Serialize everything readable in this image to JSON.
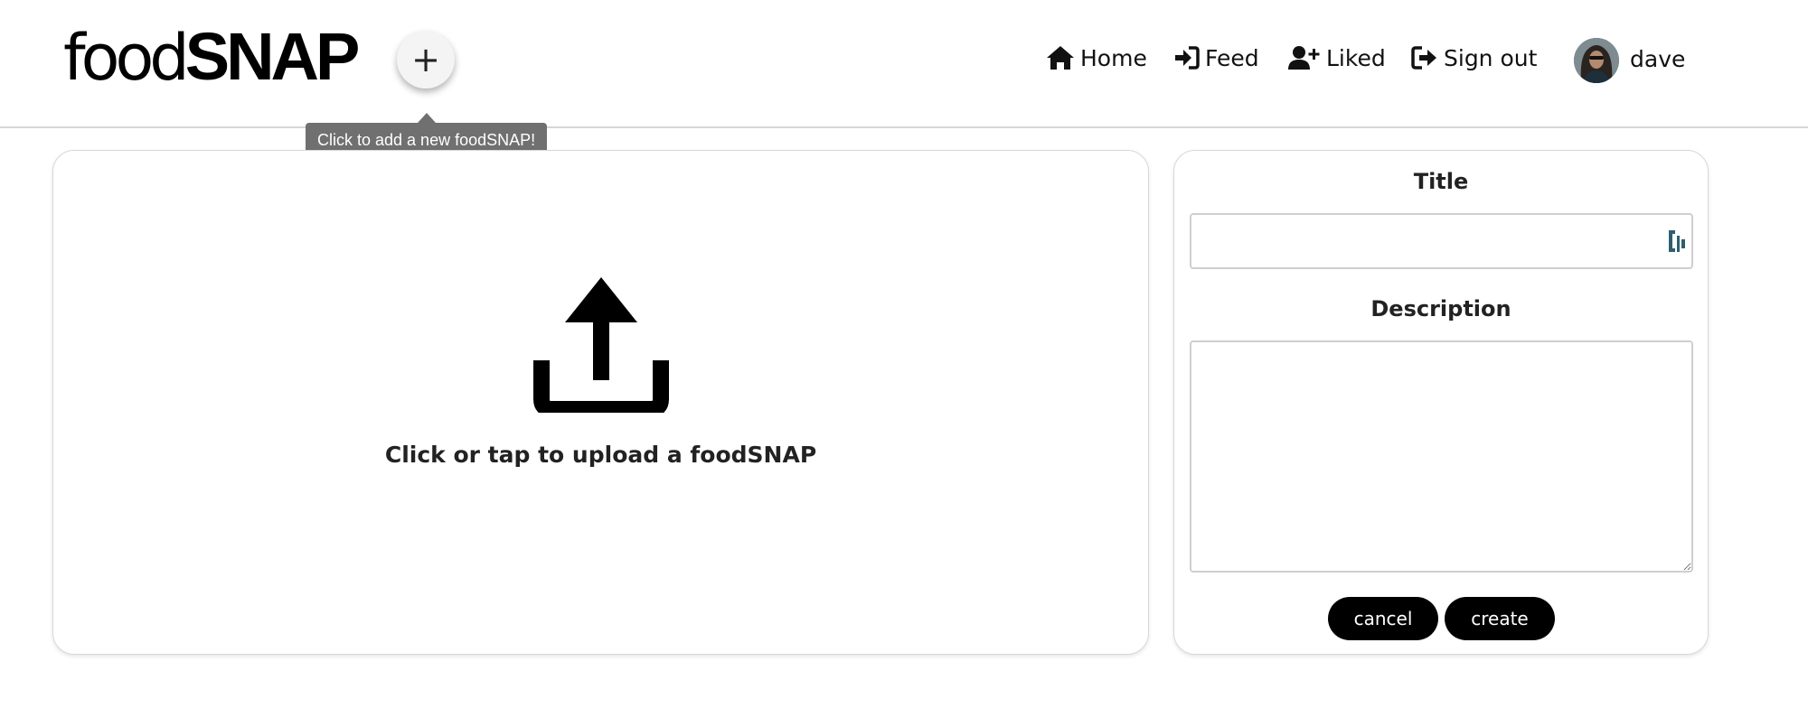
{
  "header": {
    "logo_light": "food",
    "logo_bold": "SNAP",
    "add_button_label": "+",
    "tooltip": "Click to add a new foodSNAP!",
    "nav": [
      {
        "label": "Home",
        "icon": "home-icon"
      },
      {
        "label": "Feed",
        "icon": "sign-in-icon"
      },
      {
        "label": "Liked",
        "icon": "user-plus-icon"
      },
      {
        "label": "Sign out",
        "icon": "sign-out-icon"
      }
    ],
    "username": "dave"
  },
  "upload": {
    "prompt": "Click or tap to upload a foodSNAP",
    "icon": "upload-icon"
  },
  "form": {
    "title_label": "Title",
    "title_value": "",
    "description_label": "Description",
    "description_value": "",
    "cancel_label": "cancel",
    "create_label": "create"
  },
  "colors": {
    "button_bg": "#000000",
    "tooltip_bg": "#707070",
    "password_manager_icon": "#2e5f6e"
  }
}
